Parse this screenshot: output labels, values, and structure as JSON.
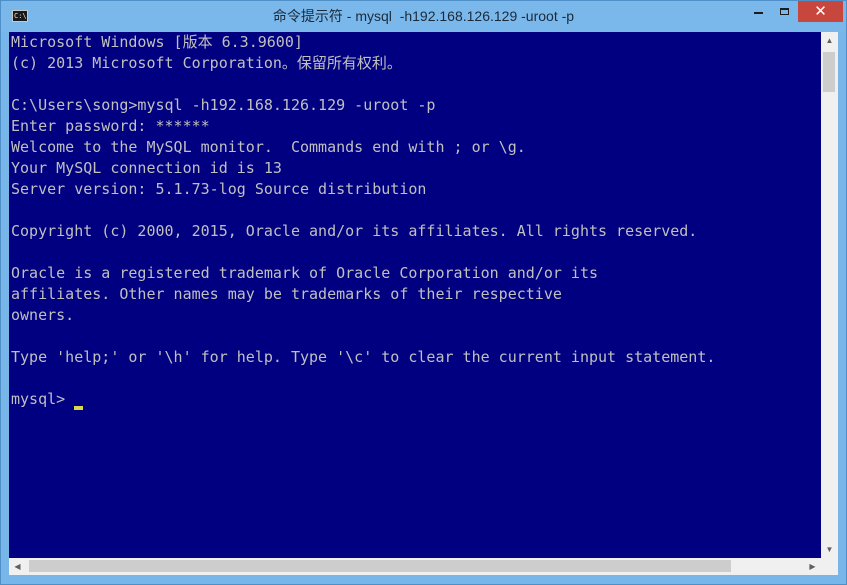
{
  "window": {
    "title": "命令提示符 - mysql  -h192.168.126.129 -uroot -p",
    "icon": "cmd-icon",
    "icon_text": "C:\\",
    "close_glyph": "✕"
  },
  "console": {
    "lines": [
      "Microsoft Windows [版本 6.3.9600]",
      "(c) 2013 Microsoft Corporation。保留所有权利。",
      "",
      "C:\\Users\\song>mysql -h192.168.126.129 -uroot -p",
      "Enter password: ******",
      "Welcome to the MySQL monitor.  Commands end with ; or \\g.",
      "Your MySQL connection id is 13",
      "Server version: 5.1.73-log Source distribution",
      "",
      "Copyright (c) 2000, 2015, Oracle and/or its affiliates. All rights reserved.",
      "",
      "Oracle is a registered trademark of Oracle Corporation and/or its",
      "affiliates. Other names may be trademarks of their respective",
      "owners.",
      "",
      "Type 'help;' or '\\h' for help. Type '\\c' to clear the current input statement.",
      "",
      "mysql> "
    ]
  },
  "colors": {
    "background": "#000080",
    "foreground": "#c0c0c0",
    "cursor": "#d9d94a"
  },
  "scrollbars": {
    "up_arrow": "▲",
    "down_arrow": "▼",
    "left_arrow": "◀",
    "right_arrow": "▶"
  }
}
